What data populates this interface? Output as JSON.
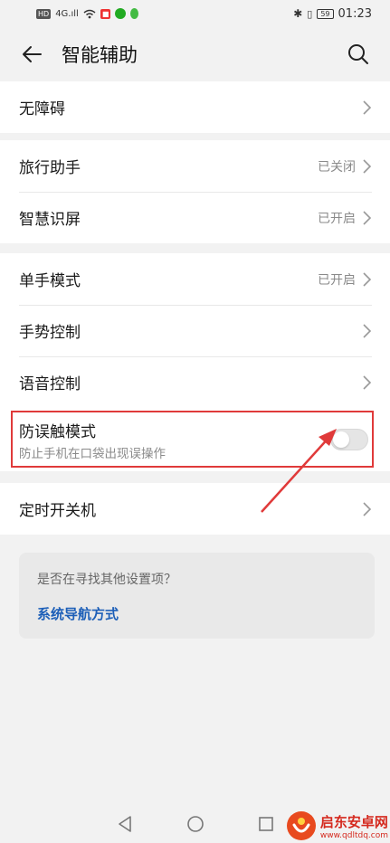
{
  "status_bar": {
    "hd_label": "HD",
    "signal_text": "4G.ıll",
    "time": "01:23",
    "battery": "59"
  },
  "header": {
    "title": "智能辅助"
  },
  "rows": {
    "accessibility": "无障碍",
    "travel_assistant": "旅行助手",
    "travel_assistant_status": "已关闭",
    "smart_screen": "智慧识屏",
    "smart_screen_status": "已开启",
    "one_hand": "单手模式",
    "one_hand_status": "已开启",
    "gesture": "手势控制",
    "voice": "语音控制",
    "scheduled_power": "定时开关机"
  },
  "toggle": {
    "title": "防误触模式",
    "subtitle": "防止手机在口袋出现误操作",
    "state": "off"
  },
  "suggest": {
    "question": "是否在寻找其他设置项？",
    "link": "系统导航方式"
  },
  "watermark": {
    "cn": "启东安卓网",
    "en": "www.qdltdq.com"
  },
  "colors": {
    "accent_link": "#1d5fb8",
    "highlight": "#e03a3a",
    "background": "#f2f2f2"
  }
}
